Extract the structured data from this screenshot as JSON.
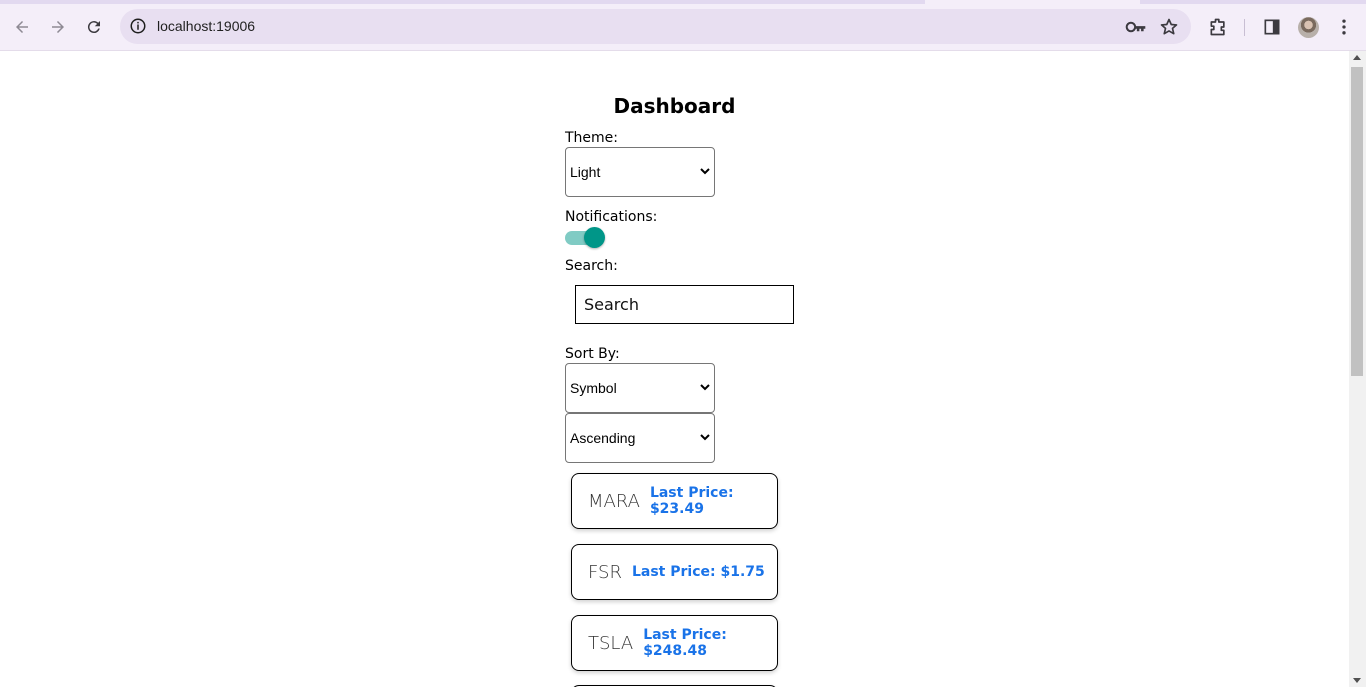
{
  "browser": {
    "url": "localhost:19006"
  },
  "dashboard": {
    "title": "Dashboard",
    "theme_label": "Theme:",
    "theme_value": "Light",
    "notifications_label": "Notifications:",
    "notifications_on": true,
    "search_label": "Search:",
    "search_placeholder": "Search",
    "sort_label": "Sort By:",
    "sort_field_value": "Symbol",
    "sort_order_value": "Ascending",
    "stocks": [
      {
        "symbol": "MARA",
        "price": "Last Price: $23.49"
      },
      {
        "symbol": "FSR",
        "price": "Last Price: $1.75"
      },
      {
        "symbol": "TSLA",
        "price": "Last Price: $248.48"
      }
    ]
  },
  "colors": {
    "price": "#1a73e8",
    "toggle_knob": "#009688",
    "toggle_track": "#80cbc4",
    "chrome_bg": "#f4eef9"
  }
}
